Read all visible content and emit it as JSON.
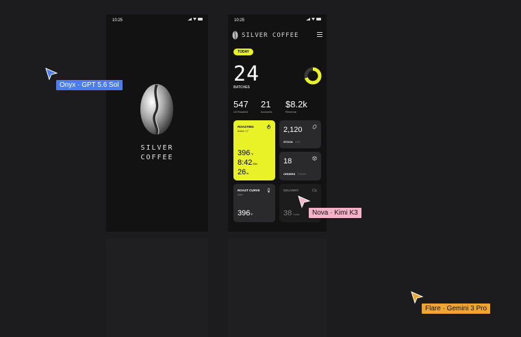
{
  "statusbar": {
    "time": "10:25"
  },
  "splash": {
    "line1": "SILVER",
    "line2": "COFFEE"
  },
  "dashboard": {
    "brand": "SILVER COFFEE",
    "today": "TODAY",
    "batches_value": "24",
    "batches_label": "BATCHES",
    "progress": 0.7,
    "stats": [
      {
        "value": "547",
        "label": "LB Roasted"
      },
      {
        "value": "21",
        "label": "Accounts"
      },
      {
        "value": "$8.2k",
        "label": "Revenue"
      }
    ],
    "roasting": {
      "title": "ROASTING",
      "subtitle": "Batch 17",
      "temp": "396",
      "temp_unit": "°F",
      "time": "8:42",
      "time_unit": "Min",
      "weight": "26",
      "weight_unit": "lb"
    },
    "stock": {
      "value": "2,120",
      "label": "STOCK",
      "sub": "LBS"
    },
    "orders": {
      "value": "18",
      "label": "ORDERS",
      "sub": "TODAY"
    },
    "curve": {
      "title": "ROAST CURVE",
      "subtitle": "Live",
      "value": "396",
      "unit": "°F"
    },
    "delivery": {
      "title": "DELIVERY",
      "value": "38",
      "unit": "Units"
    }
  },
  "cursors": [
    {
      "label": "Onyx · GPT 5.6 Sol",
      "color": "#4a7df0",
      "text_color": "#ffffff"
    },
    {
      "label": "Nova · Kimi K3",
      "color": "#f5b2c8",
      "text_color": "#111111"
    },
    {
      "label": "Flare · Gemini 3 Pro",
      "color": "#f0a530",
      "text_color": "#111111"
    }
  ],
  "colors": {
    "accent": "#e8f226",
    "canvas": "#1c1c1e",
    "frame": "#121212",
    "tile": "#2a2a2c"
  }
}
